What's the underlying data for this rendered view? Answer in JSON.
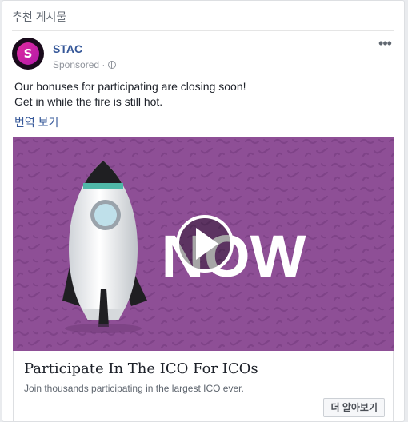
{
  "section": {
    "title": "추천 게시물"
  },
  "post": {
    "page_name": "STAC",
    "avatar_letter": "S",
    "sponsored_label": "Sponsored ·",
    "more_label": "•••",
    "text_line1": "Our bonuses for participating are closing soon!",
    "text_line2": "Get in while the fire is still hot.",
    "translate_label": "번역 보기"
  },
  "media": {
    "headline": "NOW",
    "background_color": "#8e4f96",
    "play_icon": "play-icon"
  },
  "link": {
    "title": "Participate In The ICO For ICOs",
    "description": "Join thousands participating in the largest ICO ever.",
    "cta_label": "더 알아보기"
  }
}
